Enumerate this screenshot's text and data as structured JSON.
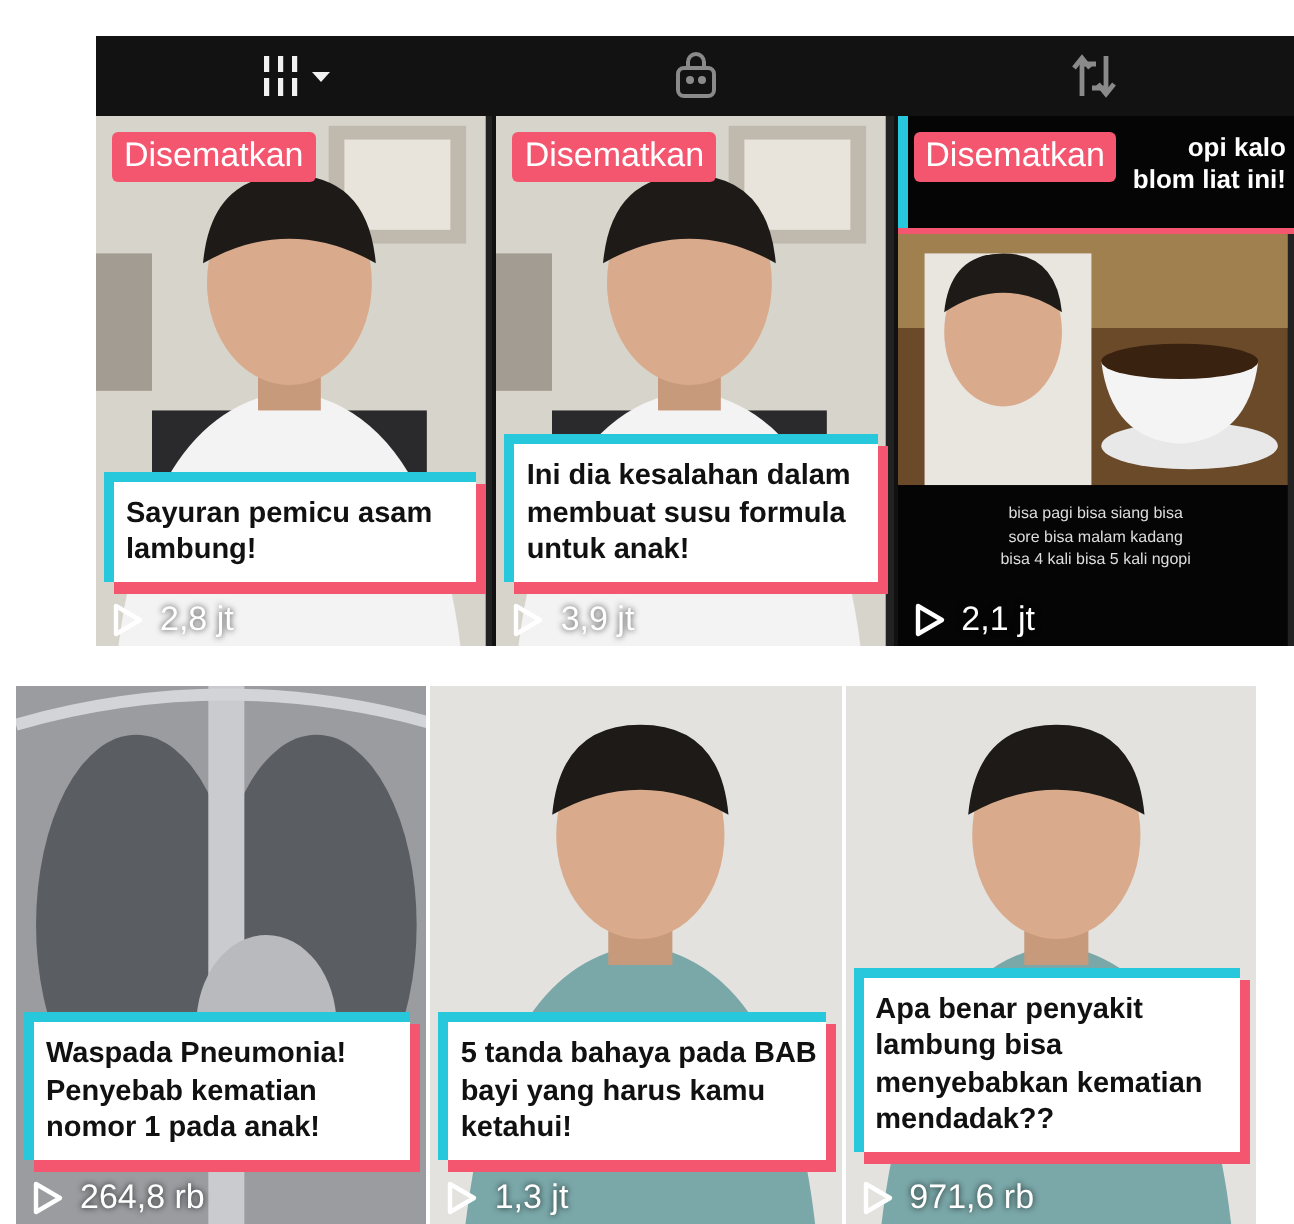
{
  "tabs": [
    {
      "kind": "grid",
      "selected": true
    },
    {
      "kind": "shop",
      "selected": false
    },
    {
      "kind": "repost",
      "selected": false
    }
  ],
  "groups": [
    {
      "videos": [
        {
          "kind": "office",
          "badge": "Disematkan",
          "caption": [
            "Sayuran pemicu asam",
            "lambung!"
          ],
          "views": "2,8 jt"
        },
        {
          "kind": "office",
          "badge": "Disematkan",
          "caption": [
            "Ini dia kesalahan dalam",
            "membuat susu formula",
            "untuk anak!"
          ],
          "views": "3,9 jt"
        },
        {
          "kind": "coffee",
          "badge": "Disematkan",
          "top_caption": [
            "opi kalo",
            "blom liat ini!"
          ],
          "subtitle": [
            "bisa pagi bisa siang bisa",
            "sore bisa malam kadang",
            "bisa 4 kali bisa 5 kali ngopi"
          ],
          "views": "2,1 jt"
        }
      ]
    },
    {
      "videos": [
        {
          "kind": "xray",
          "caption": [
            "Waspada Pneumonia!",
            "Penyebab kematian",
            "nomor 1 pada anak!"
          ],
          "views": "264,8 rb"
        },
        {
          "kind": "plain",
          "caption": [
            "5 tanda bahaya pada BAB",
            "bayi yang harus kamu",
            "ketahui!"
          ],
          "views": "1,3 jt"
        },
        {
          "kind": "plain",
          "caption": [
            "Apa benar penyakit",
            "lambung bisa",
            "menyebabkan kematian",
            "mendadak??"
          ],
          "views": "971,6 rb"
        }
      ]
    }
  ]
}
